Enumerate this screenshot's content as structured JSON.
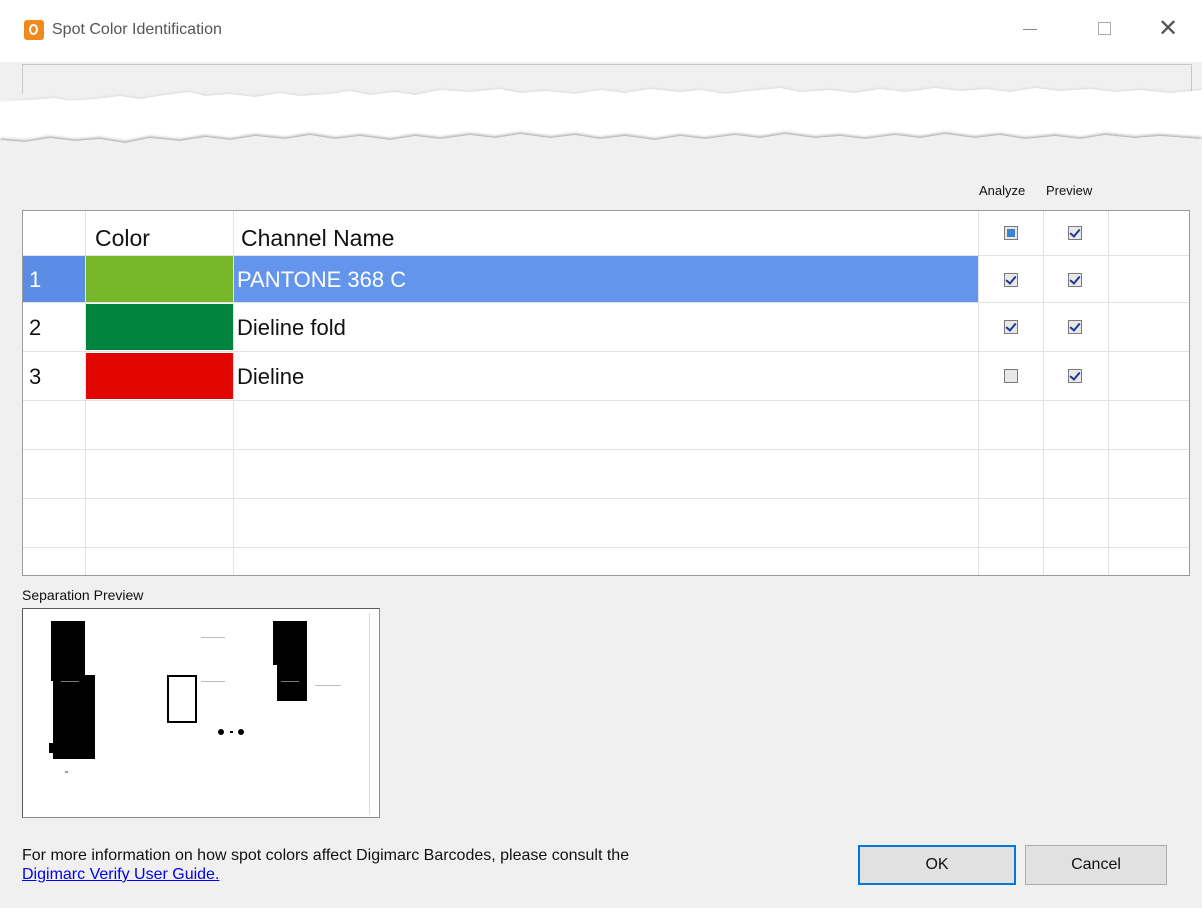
{
  "window": {
    "title": "Spot Color Identification",
    "app_icon": "digimarc-orange-icon",
    "controls": [
      "minimize-icon",
      "maximize-icon",
      "close-icon"
    ],
    "close_glyph": "✕"
  },
  "column_headers": {
    "analyze": "Analyze",
    "preview": "Preview"
  },
  "table": {
    "headers": {
      "color": "Color",
      "channel_name": "Channel Name"
    },
    "header_analyze_state": "indeterminate",
    "header_preview_state": "checked",
    "rows": [
      {
        "num": "1",
        "color": "#76b82a",
        "name": "PANTONE 368 C",
        "analyze": true,
        "preview": true,
        "selected": true
      },
      {
        "num": "2",
        "color": "#00843d",
        "name": "Dieline fold",
        "analyze": true,
        "preview": true,
        "selected": false
      },
      {
        "num": "3",
        "color": "#e10600",
        "name": "Dieline",
        "analyze": false,
        "preview": true,
        "selected": false
      }
    ],
    "selection_color": "#6495ed"
  },
  "separation_preview": {
    "label": "Separation Preview"
  },
  "footer": {
    "info_text": "For more information on how spot colors affect Digimarc Barcodes, please consult the",
    "link_text": "Digimarc Verify User Guide."
  },
  "buttons": {
    "ok": "OK",
    "cancel": "Cancel"
  }
}
